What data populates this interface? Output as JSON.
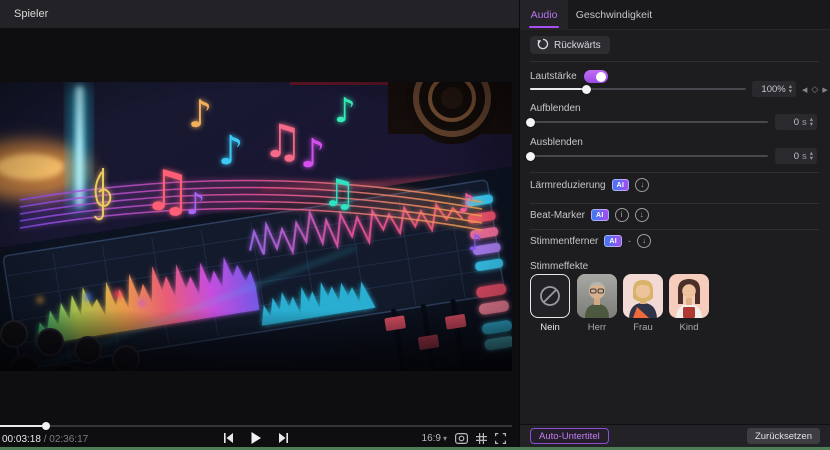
{
  "app": {
    "accent": "#a94ef2",
    "toggle_color": "#ab5ce8",
    "ai_gradient": [
      "#3a7bf5",
      "#a44df0"
    ],
    "timeline_clip_color": "#4c7d55"
  },
  "icons": {
    "caret_down": "▾",
    "step_up": "▴",
    "step_down": "▾",
    "kf_prev": "◀",
    "kf_diamond": "◇",
    "kf_next": "▶",
    "info": "i",
    "download_arrow": "↓"
  },
  "player": {
    "title": "Spieler",
    "time_current": "00:03:18",
    "time_separator": "/",
    "time_total": "02:36:17",
    "aspect_ratio": "16:9",
    "seek_percent": 9
  },
  "panel": {
    "tabs": [
      {
        "label": "Audio",
        "active": true
      },
      {
        "label": "Geschwindigkeit",
        "active": false
      }
    ],
    "reverse_button": "Rückwärts",
    "volume": {
      "label": "Lautstärke",
      "toggle_on": true,
      "value_display": "100%",
      "slider_percent": 26
    },
    "fade_in": {
      "label": "Aufblenden",
      "value": "0",
      "unit": "s",
      "slider_percent": 0
    },
    "fade_out": {
      "label": "Ausblenden",
      "value": "0",
      "unit": "s",
      "slider_percent": 0
    },
    "noise_reduction": {
      "label": "Lärmreduzierung",
      "badge": "AI"
    },
    "beat_marker": {
      "label": "Beat-Marker",
      "badge": "AI"
    },
    "voice_remover": {
      "label": "Stimmentferner",
      "badge": "AI",
      "suffix": "-"
    },
    "voice_effects": {
      "label": "Stimmeffekte",
      "items": [
        {
          "label": "Nein",
          "selected": true
        },
        {
          "label": "Herr",
          "selected": false
        },
        {
          "label": "Frau",
          "selected": false
        },
        {
          "label": "Kind",
          "selected": false
        }
      ]
    },
    "footer": {
      "auto_subtitle": "Auto-Untertitel",
      "reset": "Zurücksetzen"
    }
  }
}
